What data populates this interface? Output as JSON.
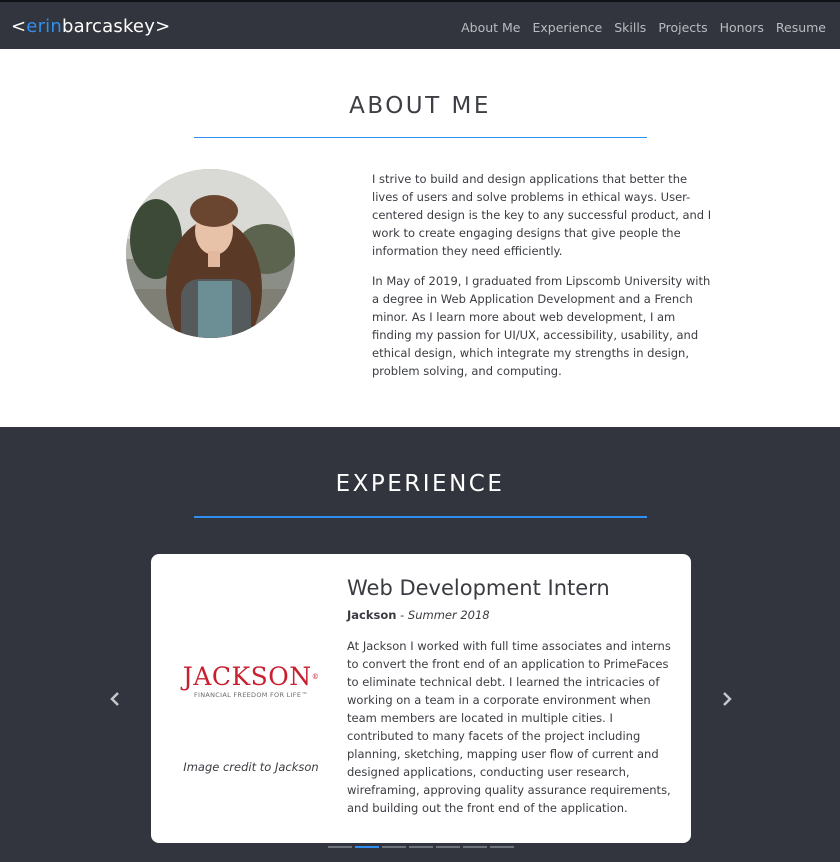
{
  "nav": {
    "brand_open": "<",
    "brand_accent": "erin",
    "brand_rest": "barcaskey",
    "brand_close": ">",
    "links": [
      "About Me",
      "Experience",
      "Skills",
      "Projects",
      "Honors",
      "Resume"
    ]
  },
  "about": {
    "title": "ABOUT ME",
    "paragraphs": [
      "I strive to build and design applications that better the lives of users and solve problems in ethical ways. User-centered design is the key to any successful product, and I work to create engaging designs that give people the information they need efficiently.",
      "In May of 2019, I graduated from Lipscomb University with a degree in Web Application Development and a French minor. As I learn more about web development, I am finding my passion for UI/UX, accessibility, usability, and ethical design, which integrate my strengths in design, problem solving, and computing."
    ]
  },
  "experience": {
    "title": "EXPERIENCE",
    "card": {
      "logo_text": "JACKSON",
      "logo_reg": "®",
      "logo_tagline": "FINANCIAL FREEDOM FOR LIFE™",
      "image_credit": "Image credit to Jackson",
      "job_title": "Web Development Intern",
      "company": "Jackson",
      "separator": " - ",
      "dates": "Summer 2018",
      "description": "At Jackson I worked with full time associates and interns to convert the front end of an application to PrimeFaces to eliminate technical debt. I learned the intricacies of working on a team in a corporate environment when team members are located in multiple cities. I contributed to many facets of the project including planning, sketching, mapping user flow of current and designed applications, conducting user research, wireframing, approving quality assurance requirements, and building out the front end of the application."
    },
    "carousel": {
      "total_slides": 7,
      "active_slide": 2
    }
  },
  "colors": {
    "accent": "#2f8ff0",
    "dark_bg": "#32353d",
    "logo_red": "#c8202f"
  },
  "icons": {
    "prev": "chevron-left-icon",
    "next": "chevron-right-icon"
  }
}
